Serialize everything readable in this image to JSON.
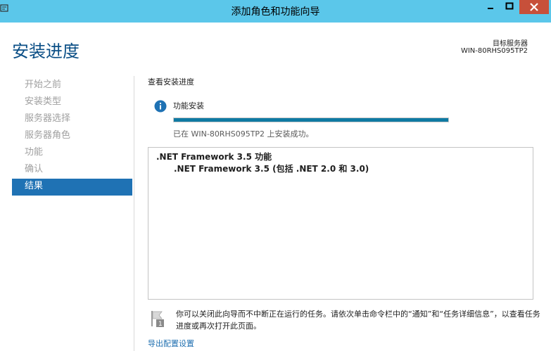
{
  "window": {
    "title": "添加角色和功能向导"
  },
  "header": {
    "page_title": "安装进度",
    "server_label": "目标服务器",
    "server_name": "WIN-80RHS095TP2"
  },
  "nav": {
    "items": [
      {
        "label": "开始之前",
        "active": false
      },
      {
        "label": "安装类型",
        "active": false
      },
      {
        "label": "服务器选择",
        "active": false
      },
      {
        "label": "服务器角色",
        "active": false
      },
      {
        "label": "功能",
        "active": false
      },
      {
        "label": "确认",
        "active": false
      },
      {
        "label": "结果",
        "active": true
      }
    ]
  },
  "main": {
    "section_title": "查看安装进度",
    "feature_label": "功能安装",
    "progress_percent": 100,
    "status_text": "已在 WIN-80RHS095TP2 上安装成功。",
    "results": {
      "main_item": ".NET Framework 3.5 功能",
      "sub_item": ".NET Framework 3.5 (包括 .NET 2.0 和 3.0)"
    },
    "note_text": "你可以关闭此向导而不中断正在运行的任务。请依次单击命令栏中的“通知”和“任务详细信息”，以查看任务进度或再次打开此页面。",
    "export_link": "导出配置设置"
  },
  "colors": {
    "titlebar": "#5bc7ea",
    "close_button": "#c7503a",
    "accent": "#1f72b4",
    "progress": "#0f7aa3",
    "page_title": "#0b4f86"
  },
  "icons": [
    "app-icon",
    "minimize-icon",
    "maximize-icon",
    "close-icon",
    "info-icon",
    "note-flag-icon"
  ]
}
